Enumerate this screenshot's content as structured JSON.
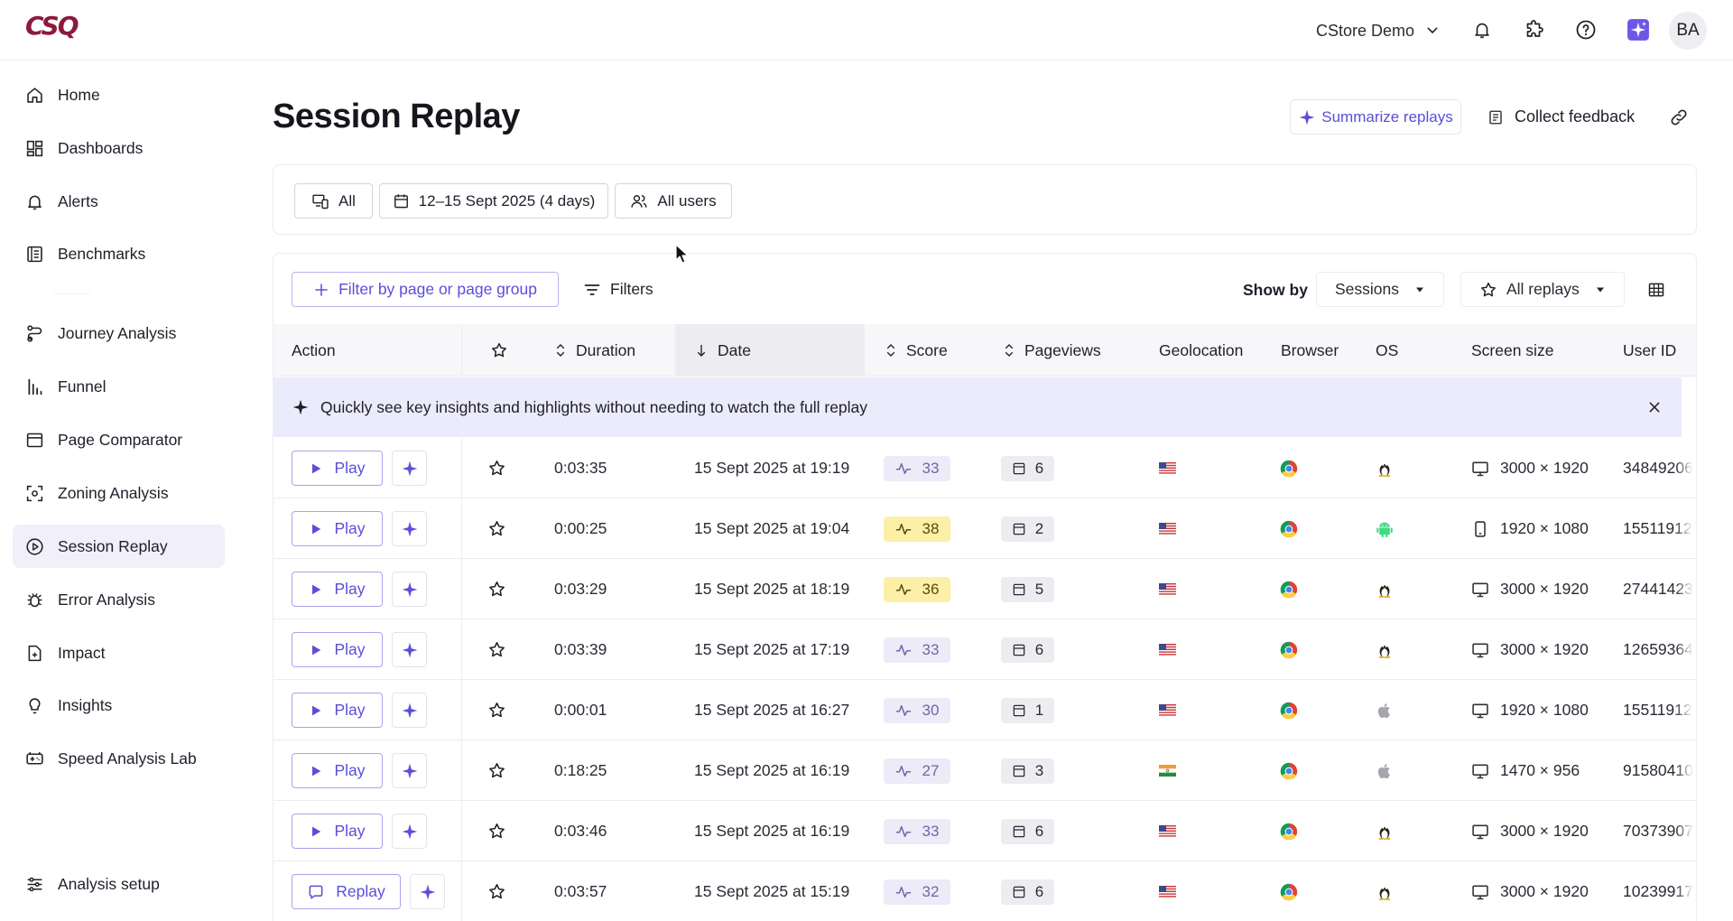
{
  "app": {
    "logo": "CSQ",
    "workspace": "CStore Demo",
    "avatar": "BA"
  },
  "nav": [
    {
      "label": "Home",
      "icon": "home-icon"
    },
    {
      "label": "Dashboards",
      "icon": "dashboards-icon"
    },
    {
      "label": "Alerts",
      "icon": "bell-icon"
    },
    {
      "label": "Benchmarks",
      "icon": "benchmarks-icon"
    },
    {
      "label": "Journey Analysis",
      "icon": "journey-icon"
    },
    {
      "label": "Funnel",
      "icon": "funnel-icon"
    },
    {
      "label": "Page Comparator",
      "icon": "page-comparator-icon"
    },
    {
      "label": "Zoning Analysis",
      "icon": "zoning-icon"
    },
    {
      "label": "Session Replay",
      "icon": "play-circle-icon",
      "active": true
    },
    {
      "label": "Error Analysis",
      "icon": "bug-icon"
    },
    {
      "label": "Impact",
      "icon": "impact-icon"
    },
    {
      "label": "Insights",
      "icon": "lightbulb-icon"
    },
    {
      "label": "Speed Analysis Lab",
      "icon": "speed-icon"
    },
    {
      "label": "Analysis setup",
      "icon": "sliders-icon"
    }
  ],
  "page": {
    "title": "Session Replay",
    "summarize_label": "Summarize replays",
    "collect_label": "Collect feedback"
  },
  "filters": {
    "device": "All",
    "date_range": "12–15 Sept 2025 (4 days)",
    "users": "All users"
  },
  "toolbar": {
    "filter_page_label": "Filter by page or page group",
    "filters_label": "Filters",
    "show_by_label": "Show by",
    "show_by_value": "Sessions",
    "replays_value": "All replays"
  },
  "table": {
    "columns": {
      "action": "Action",
      "duration": "Duration",
      "date": "Date",
      "score": "Score",
      "pageviews": "Pageviews",
      "geolocation": "Geolocation",
      "browser": "Browser",
      "os": "OS",
      "screen_size": "Screen size",
      "user_id": "User ID"
    },
    "banner": "Quickly see key insights and highlights without needing to watch the full replay",
    "rows": [
      {
        "action": "Play",
        "duration": "0:03:35",
        "date": "15 Sept 2025 at 19:19",
        "score": "33",
        "score_warn": false,
        "pageviews": "6",
        "geo": "us",
        "os": "linux",
        "device": "desktop",
        "screen": "3000 × 1920",
        "user_id": "34849206"
      },
      {
        "action": "Play",
        "duration": "0:00:25",
        "date": "15 Sept 2025 at 19:04",
        "score": "38",
        "score_warn": true,
        "pageviews": "2",
        "geo": "us",
        "os": "android",
        "device": "mobile",
        "screen": "1920 × 1080",
        "user_id": "15511912"
      },
      {
        "action": "Play",
        "duration": "0:03:29",
        "date": "15 Sept 2025 at 18:19",
        "score": "36",
        "score_warn": true,
        "pageviews": "5",
        "geo": "us",
        "os": "linux",
        "device": "desktop",
        "screen": "3000 × 1920",
        "user_id": "27441423"
      },
      {
        "action": "Play",
        "duration": "0:03:39",
        "date": "15 Sept 2025 at 17:19",
        "score": "33",
        "score_warn": false,
        "pageviews": "6",
        "geo": "us",
        "os": "linux",
        "device": "desktop",
        "screen": "3000 × 1920",
        "user_id": "12659364"
      },
      {
        "action": "Play",
        "duration": "0:00:01",
        "date": "15 Sept 2025 at 16:27",
        "score": "30",
        "score_warn": false,
        "pageviews": "1",
        "geo": "us",
        "os": "apple",
        "device": "desktop",
        "screen": "1920 × 1080",
        "user_id": "15511912"
      },
      {
        "action": "Play",
        "duration": "0:18:25",
        "date": "15 Sept 2025 at 16:19",
        "score": "27",
        "score_warn": false,
        "pageviews": "3",
        "geo": "in",
        "os": "apple",
        "device": "desktop",
        "screen": "1470 × 956",
        "user_id": "91580410"
      },
      {
        "action": "Play",
        "duration": "0:03:46",
        "date": "15 Sept 2025 at 16:19",
        "score": "33",
        "score_warn": false,
        "pageviews": "6",
        "geo": "us",
        "os": "linux",
        "device": "desktop",
        "screen": "3000 × 1920",
        "user_id": "70373907"
      },
      {
        "action": "Replay",
        "duration": "0:03:57",
        "date": "15 Sept 2025 at 15:19",
        "score": "32",
        "score_warn": false,
        "pageviews": "6",
        "geo": "us",
        "os": "linux",
        "device": "desktop",
        "screen": "3000 × 1920",
        "user_id": "10239917"
      }
    ]
  },
  "colors": {
    "accent": "#5b4ed8",
    "brand": "#8b1a3c",
    "warn": "#fcefa6"
  }
}
